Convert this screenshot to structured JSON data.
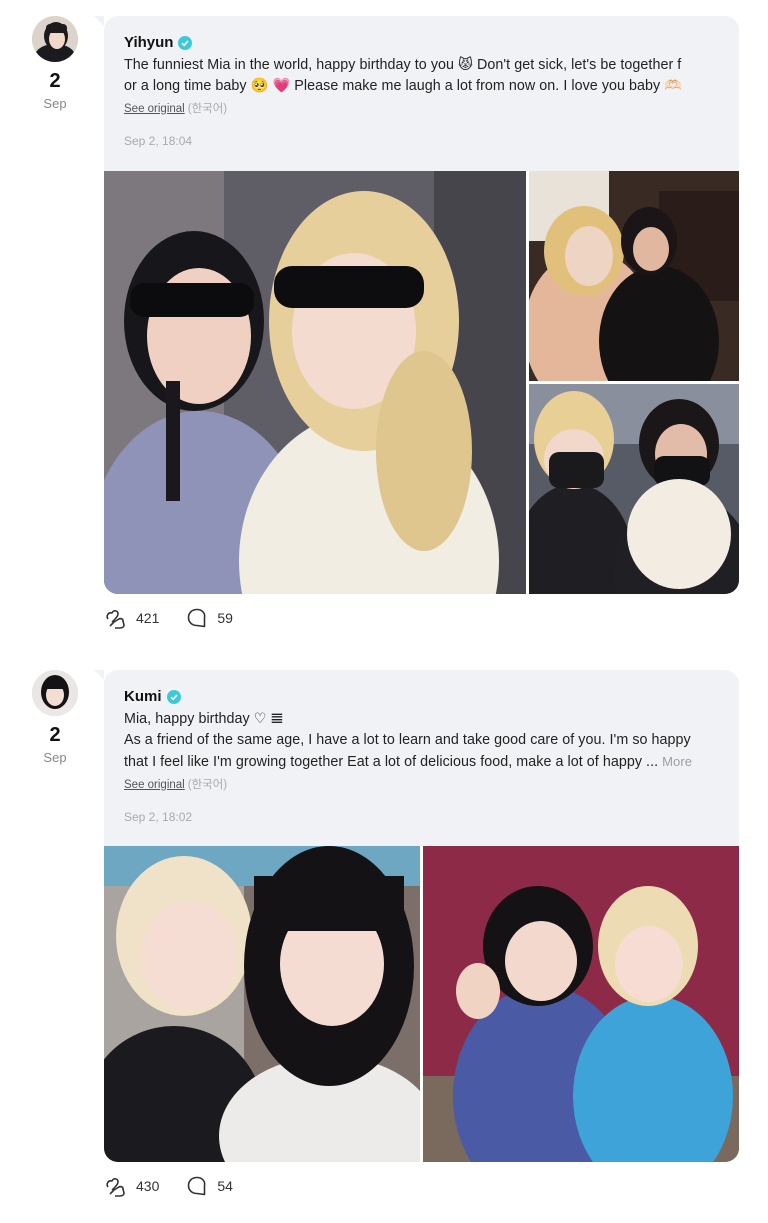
{
  "posts": [
    {
      "author": "Yihyun",
      "day": "2",
      "month": "Sep",
      "lines": [
        "The funniest Mia in the world, happy birthday to you 😾 Don't get sick, let's be together f",
        "or a long time baby 🥺 💗 Please make me laugh a lot from now on. I love you baby 🫶🏻"
      ],
      "more_label": "",
      "see_original": "See original",
      "language": "(한국어)",
      "timestamp": "Sep 2, 18:04",
      "likes": "421",
      "comments": "59"
    },
    {
      "author": "Kumi",
      "day": "2",
      "month": "Sep",
      "lines": [
        "Mia, happy birthday ♡ 𝌆",
        "As a friend of the same age, I have a lot to learn and take good care of you. I'm so happy",
        "that I feel like I'm growing together Eat a lot of delicious food, make a lot of happy ..."
      ],
      "more_label": "More",
      "see_original": "See original",
      "language": "(한국어)",
      "timestamp": "Sep 2, 18:02",
      "likes": "430",
      "comments": "54"
    }
  ],
  "icons": {
    "like": "heart-hand-icon",
    "comment": "speech-bubble-icon",
    "verified": "verified-check-icon"
  },
  "colors": {
    "bubble": "#f1f2f5",
    "verified": "#3ec9d6",
    "muted": "#aaaaaa"
  }
}
